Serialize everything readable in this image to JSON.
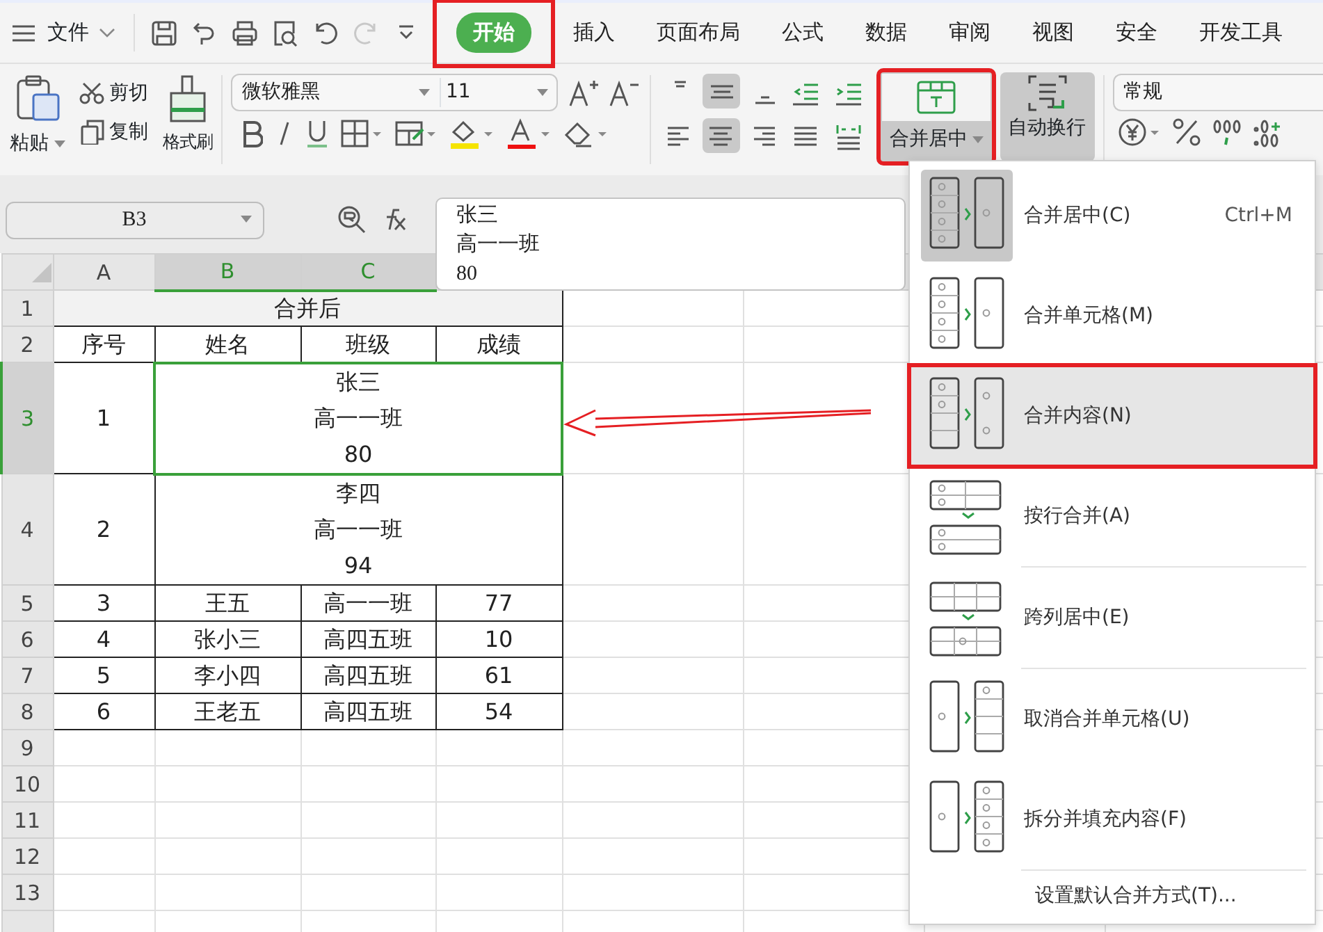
{
  "menu_bar": {
    "file_label": "文件",
    "quick_access": [
      {
        "kind": "save",
        "disabled": false
      },
      {
        "kind": "hook",
        "disabled": false
      },
      {
        "kind": "print",
        "disabled": false
      },
      {
        "kind": "preview",
        "disabled": false
      },
      {
        "kind": "undo",
        "disabled": false
      },
      {
        "kind": "redo",
        "disabled": true
      },
      {
        "kind": "more",
        "disabled": false
      }
    ],
    "tabs": [
      {
        "label": "开始",
        "selected": true,
        "annotated": true
      },
      {
        "label": "插入",
        "selected": false,
        "annotated": false
      },
      {
        "label": "页面布局",
        "selected": false,
        "annotated": false
      },
      {
        "label": "公式",
        "selected": false,
        "annotated": false
      },
      {
        "label": "数据",
        "selected": false,
        "annotated": false
      },
      {
        "label": "审阅",
        "selected": false,
        "annotated": false
      },
      {
        "label": "视图",
        "selected": false,
        "annotated": false
      },
      {
        "label": "安全",
        "selected": false,
        "annotated": false
      },
      {
        "label": "开发工具",
        "selected": false,
        "annotated": false
      }
    ]
  },
  "ribbon": {
    "paste": "粘贴",
    "cut": "剪切",
    "copy": "复制",
    "format_painter": "格式刷",
    "font_name": "微软雅黑",
    "font_size": "11",
    "align_top": [
      {
        "kind": "top",
        "on": false
      },
      {
        "kind": "middle",
        "on": true
      },
      {
        "kind": "bottom",
        "on": false
      },
      {
        "kind": "outdent",
        "on": false
      },
      {
        "kind": "indent",
        "on": false
      }
    ],
    "align_bottom": [
      {
        "kind": "left",
        "on": false
      },
      {
        "kind": "center",
        "on": true
      },
      {
        "kind": "right",
        "on": false
      },
      {
        "kind": "justify",
        "on": false
      },
      {
        "kind": "distribute",
        "on": false
      }
    ],
    "merge": {
      "label": "合并居中",
      "annotated": true
    },
    "wrap": {
      "label": "自动换行",
      "on": true
    },
    "number_format": "常规"
  },
  "name_box": "B3",
  "formula_lines": [
    "张三",
    "高一一班",
    "80"
  ],
  "columns": [
    {
      "label": "A",
      "selected": false
    },
    {
      "label": "B",
      "selected": true
    },
    {
      "label": "C",
      "selected": true
    }
  ],
  "rows": [
    {
      "label": "1",
      "selected": false
    },
    {
      "label": "2",
      "selected": false
    },
    {
      "label": "3",
      "selected": true
    },
    {
      "label": "4",
      "selected": false
    },
    {
      "label": "5",
      "selected": false
    },
    {
      "label": "6",
      "selected": false
    },
    {
      "label": "7",
      "selected": false
    },
    {
      "label": "8",
      "selected": false
    },
    {
      "label": "9",
      "selected": false
    },
    {
      "label": "10",
      "selected": false
    },
    {
      "label": "11",
      "selected": false
    },
    {
      "label": "12",
      "selected": false
    },
    {
      "label": "13",
      "selected": false
    }
  ],
  "sheet": {
    "title": "合并后",
    "headers": [
      "序号",
      "姓名",
      "班级",
      "成绩"
    ],
    "records": [
      {
        "kind": "merged",
        "no": "1",
        "lines": [
          "张三",
          "高一一班",
          "80"
        ],
        "selected": true
      },
      {
        "kind": "merged",
        "no": "2",
        "lines": [
          "李四",
          "高一一班",
          "94"
        ],
        "selected": false
      },
      {
        "kind": "plain",
        "no": "3",
        "name": "王五",
        "class": "高一一班",
        "score": "77"
      },
      {
        "kind": "plain",
        "no": "4",
        "name": "张小三",
        "class": "高四五班",
        "score": "10"
      },
      {
        "kind": "plain",
        "no": "5",
        "name": "李小四",
        "class": "高四五班",
        "score": "61"
      },
      {
        "kind": "plain",
        "no": "6",
        "name": "王老五",
        "class": "高四五班",
        "score": "54"
      }
    ]
  },
  "merge_menu": [
    {
      "kind": "merge-center",
      "label": "合并居中(C)",
      "shortcut": "Ctrl+M",
      "selected": false,
      "default": true,
      "annotated": false,
      "separator_before": false
    },
    {
      "kind": "merge-cells",
      "label": "合并单元格(M)",
      "selected": false,
      "default": false,
      "annotated": false,
      "separator_before": false
    },
    {
      "kind": "merge-content",
      "label": "合并内容(N)",
      "selected": true,
      "default": false,
      "annotated": true,
      "separator_before": false
    },
    {
      "kind": "merge-rows",
      "label": "按行合并(A)",
      "selected": false,
      "default": false,
      "annotated": false,
      "separator_before": false
    },
    {
      "kind": "center-across",
      "label": "跨列居中(E)",
      "selected": false,
      "default": false,
      "annotated": false,
      "separator_before": true
    },
    {
      "kind": "unmerge",
      "label": "取消合并单元格(U)",
      "selected": false,
      "default": false,
      "annotated": false,
      "separator_before": true
    },
    {
      "kind": "split-fill",
      "label": "拆分并填充内容(F)",
      "selected": false,
      "default": false,
      "annotated": false,
      "separator_before": false
    },
    {
      "kind": "text",
      "label": "设置默认合并方式(T)...",
      "selected": false,
      "default": false,
      "annotated": false,
      "separator_before": true
    }
  ]
}
